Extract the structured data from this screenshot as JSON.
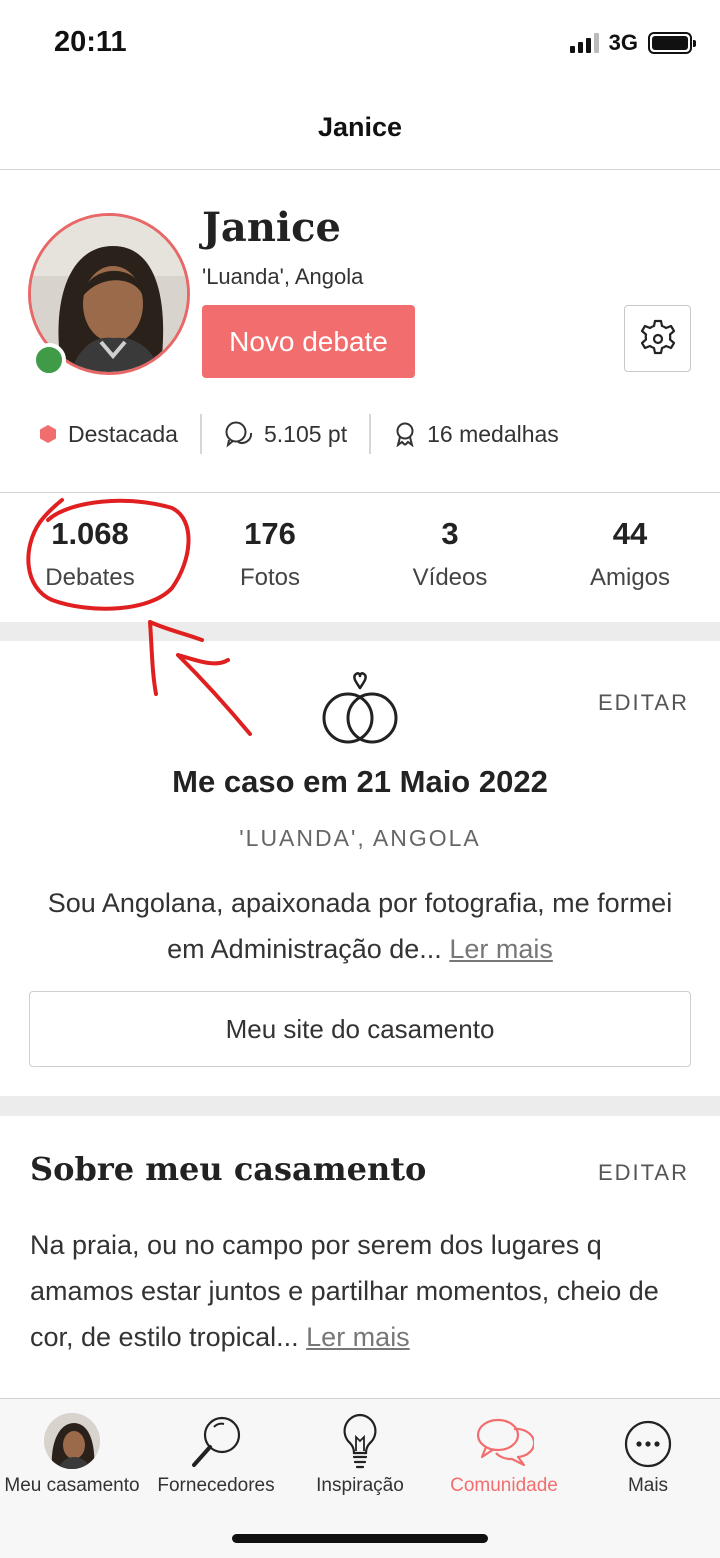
{
  "status_bar": {
    "time": "20:11",
    "network": "3G"
  },
  "navbar": {
    "title": "Janice"
  },
  "profile": {
    "name": "Janice",
    "location": "'Luanda', Angola",
    "new_debate_label": "Novo debate",
    "badges": [
      {
        "icon": "hexagon-icon",
        "label": "Destacada",
        "color": "#f26e6e"
      },
      {
        "icon": "chat-bubbles-icon",
        "label": "5.105 pt"
      },
      {
        "icon": "medal-icon",
        "label": "16 medalhas"
      }
    ]
  },
  "stats": [
    {
      "value": "1.068",
      "label": "Debates"
    },
    {
      "value": "176",
      "label": "Fotos"
    },
    {
      "value": "3",
      "label": "Vídeos"
    },
    {
      "value": "44",
      "label": "Amigos"
    }
  ],
  "wedding": {
    "edit_label": "EDITAR",
    "date": "Me caso em 21 Maio 2022",
    "location": "'LUANDA', ANGOLA",
    "bio": "Sou Angolana, apaixonada por fotografia, me formei em Administração de...",
    "read_more": "Ler mais",
    "site_button": "Meu site do casamento"
  },
  "about": {
    "title": "Sobre meu casamento",
    "edit_label": "EDITAR",
    "text": "Na praia, ou no campo por serem dos lugares q amamos estar juntos e partilhar momentos, cheio de cor, de estilo tropical...",
    "read_more": "Ler mais"
  },
  "tab_bar": [
    {
      "label": "Meu casamento",
      "icon": "avatar"
    },
    {
      "label": "Fornecedores",
      "icon": "magnifier-icon"
    },
    {
      "label": "Inspiração",
      "icon": "lightbulb-icon"
    },
    {
      "label": "Comunidade",
      "icon": "chat-bubbles-icon",
      "active": true
    },
    {
      "label": "Mais",
      "icon": "more-icon"
    }
  ],
  "colors": {
    "accent": "#f26e6e",
    "online": "#3f9b47",
    "annotation": "#e02020"
  }
}
